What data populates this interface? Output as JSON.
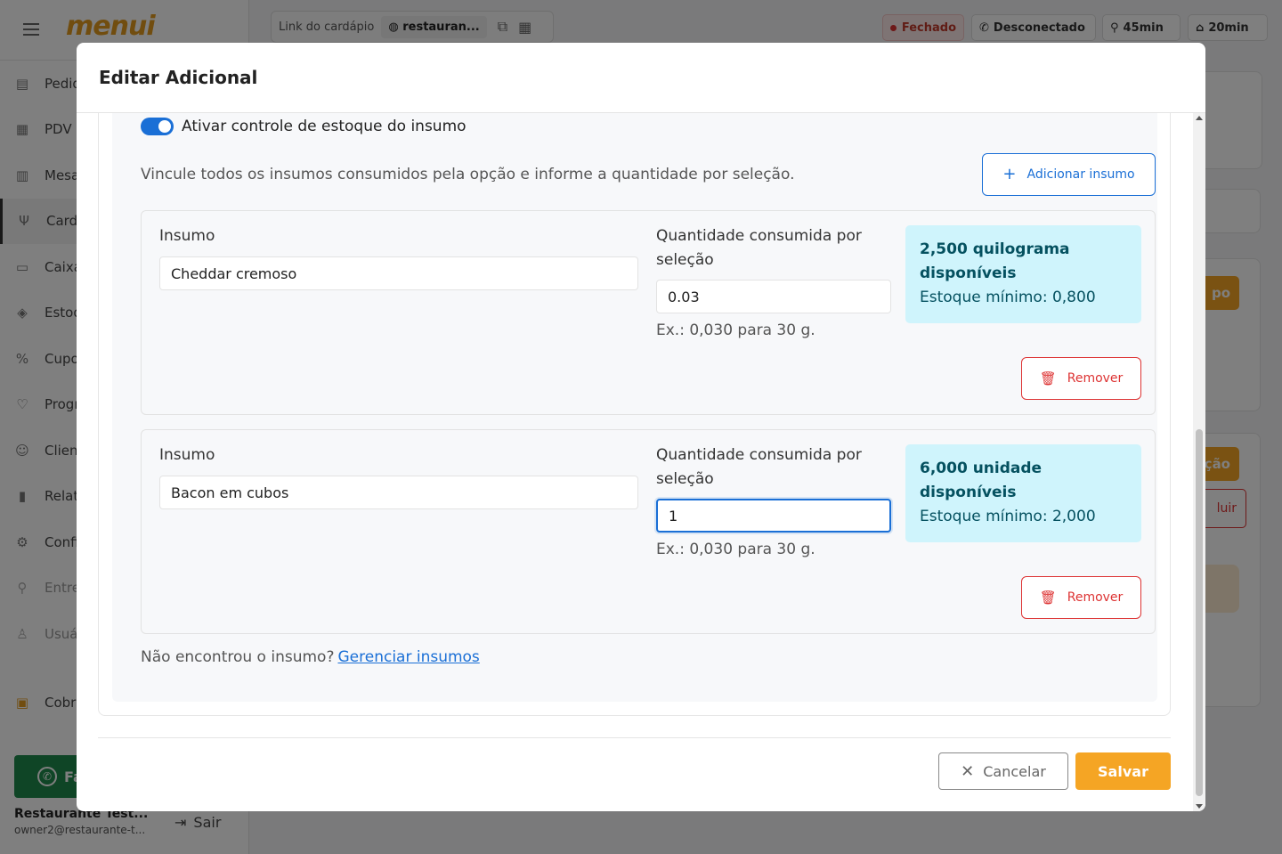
{
  "app": {
    "logo": "menui",
    "nav": [
      {
        "label": "Pedidos",
        "icon": "receipt-icon"
      },
      {
        "label": "PDV",
        "icon": "calculator-icon"
      },
      {
        "label": "Mesas",
        "icon": "table-icon"
      },
      {
        "label": "Cardápio",
        "icon": "utensils-icon"
      },
      {
        "label": "Caixa",
        "icon": "cash-icon"
      },
      {
        "label": "Estoque",
        "icon": "box-icon"
      },
      {
        "label": "Cupons",
        "icon": "percent-icon"
      },
      {
        "label": "Programa",
        "icon": "heart-icon"
      },
      {
        "label": "Clientes",
        "icon": "users-icon"
      },
      {
        "label": "Relatórios",
        "icon": "chart-icon"
      },
      {
        "label": "Configurações",
        "icon": "gear-icon"
      },
      {
        "label": "Entregadores",
        "icon": "bike-icon"
      },
      {
        "label": "Usuários",
        "icon": "user-icon"
      },
      {
        "label": "Cobrança",
        "icon": "clipboard-icon"
      }
    ],
    "whatsapp_label": "Fale",
    "profile_name": "Restaurante Test...",
    "profile_email": "owner2@restaurante-t...",
    "logout_label": "Sair"
  },
  "topbar": {
    "link_label": "Link do cardápio",
    "link_value": "restauran...",
    "status_closed": "Fechado",
    "whatsapp_status": "Desconectado",
    "delivery_time": "45min",
    "pickup_time": "20min"
  },
  "background": {
    "button1": "po",
    "button2": "ção",
    "button3": "luir"
  },
  "modal": {
    "title": "Editar Adicional",
    "toggle_label": "Ativar controle de estoque do insumo",
    "toggle_on": true,
    "help_text": "Vincule todos os insumos consumidos pela opção e informe a quantidade por seleção.",
    "add_button": "Adicionar insumo",
    "supplies": [
      {
        "insumo_label": "Insumo",
        "insumo_value": "Cheddar cremoso",
        "qty_label": "Quantidade consumida por seleção",
        "qty_value": "0.03",
        "qty_hint": "Ex.: 0,030 para 30 g.",
        "available": "2,500 quilograma disponíveis",
        "minimum": "Estoque mínimo: 0,800",
        "remove_label": "Remover"
      },
      {
        "insumo_label": "Insumo",
        "insumo_value": "Bacon em cubos",
        "qty_label": "Quantidade consumida por seleção",
        "qty_value": "1",
        "qty_hint": "Ex.: 0,030 para 30 g.",
        "available": "6,000 unidade disponíveis",
        "minimum": "Estoque mínimo: 2,000",
        "remove_label": "Remover"
      }
    ],
    "not_found_text": "Não encontrou o insumo?",
    "manage_link": "Gerenciar insumos",
    "cancel_label": "Cancelar",
    "save_label": "Salvar"
  },
  "colors": {
    "accent": "#f5a524",
    "primary": "#1a6fd6",
    "danger": "#dd3333",
    "info_bg": "#cff4fc"
  }
}
